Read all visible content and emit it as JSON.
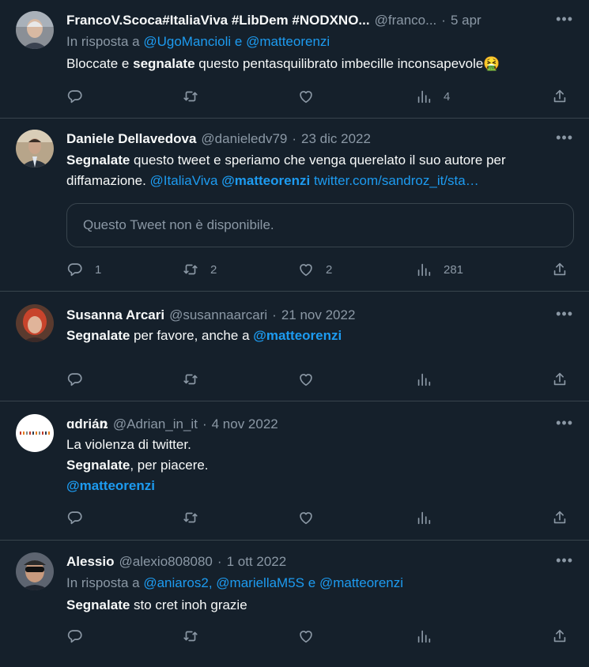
{
  "tweets": [
    {
      "name": "FrancoV.Scoca#ItaliaViva #LibDem #NODXNO...",
      "handle": "@franco...",
      "sep": "·",
      "date": "5 apr",
      "reply_prefix": "In risposta a",
      "reply_users": [
        "@UgoMancioli",
        "@matteorenzi"
      ],
      "reply_joiners": [
        "e"
      ],
      "text": [
        [
          {
            "t": "Bloccate e ",
            "s": "normal"
          },
          {
            "t": "segnalate",
            "s": "bold"
          },
          {
            "t": " questo pentasquilibrato imbecille inconsapevole🤮",
            "s": "normal"
          }
        ]
      ],
      "stats": {
        "replies": "",
        "retweets": "",
        "likes": "",
        "views": "4"
      }
    },
    {
      "name": "Daniele Dellavedova",
      "handle": "@danieledv79",
      "sep": "·",
      "date": "23 dic 2022",
      "text": [
        [
          {
            "t": "Segnalate",
            "s": "bold"
          },
          {
            "t": " questo tweet e speriamo che venga querelato il suo autore per",
            "s": "normal"
          }
        ],
        [
          {
            "t": "diffamazione. ",
            "s": "normal"
          },
          {
            "t": "@ItaliaViva",
            "s": "link"
          },
          {
            "t": " ",
            "s": "normal"
          },
          {
            "t": "@matteorenzi",
            "s": "linkbold"
          },
          {
            "t": " ",
            "s": "normal"
          },
          {
            "t": "twitter.com/sandroz_it/sta…",
            "s": "link"
          }
        ]
      ],
      "quoted_unavailable": "Questo Tweet non è disponibile.",
      "stats": {
        "replies": "1",
        "retweets": "2",
        "likes": "2",
        "views": "281"
      }
    },
    {
      "name": "Susanna Arcari",
      "handle": "@susannaarcari",
      "sep": "·",
      "date": "21 nov 2022",
      "text": [
        [
          {
            "t": "Segnalate",
            "s": "bold"
          },
          {
            "t": " per favore, anche a ",
            "s": "normal"
          },
          {
            "t": "@matteorenzi",
            "s": "linkbold"
          }
        ]
      ],
      "stats": {
        "replies": "",
        "retweets": "",
        "likes": "",
        "views": ""
      }
    },
    {
      "name": "ɑdriáռ",
      "handle": "@Adrian_in_it",
      "sep": "·",
      "date": "4 nov 2022",
      "text": [
        [
          {
            "t": "La violenza di twitter.",
            "s": "normal"
          }
        ],
        [
          {
            "t": "Segnalate",
            "s": "bold"
          },
          {
            "t": ", per piacere.",
            "s": "normal"
          }
        ],
        [
          {
            "t": "@matteorenzi",
            "s": "linkbold"
          }
        ]
      ],
      "stats": {
        "replies": "",
        "retweets": "",
        "likes": "",
        "views": ""
      }
    },
    {
      "name": "Alessio",
      "handle": "@alexio808080",
      "sep": "·",
      "date": "1 ott 2022",
      "reply_prefix": "In risposta a",
      "reply_users": [
        "@aniaros2",
        "@mariellaM5S",
        "@matteorenzi"
      ],
      "reply_joiners": [
        ",",
        "e"
      ],
      "text": [
        [
          {
            "t": "Segnalate",
            "s": "bold"
          },
          {
            "t": " sto cret inoh  grazie",
            "s": "normal"
          }
        ]
      ],
      "stats": {
        "replies": "",
        "retweets": "",
        "likes": "",
        "views": ""
      }
    }
  ],
  "icons": {
    "reply": "reply-icon",
    "retweet": "retweet-icon",
    "like": "heart-icon",
    "views": "views-icon",
    "share": "share-icon",
    "more": "more-icon"
  },
  "colors": {
    "background": "#15202b",
    "text": "#f7f9f9",
    "secondary": "#8b98a5",
    "link": "#1d9bf0",
    "border": "#38444d"
  }
}
